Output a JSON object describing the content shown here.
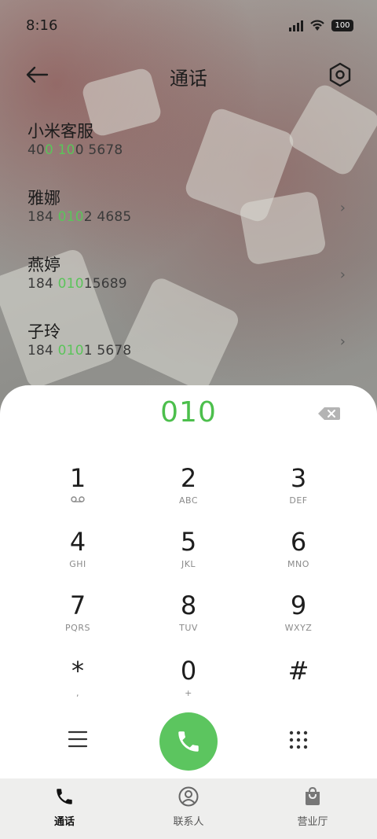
{
  "status_bar": {
    "time": "8:16",
    "battery": "100"
  },
  "header": {
    "title": "通话",
    "back_icon": "arrow-left-icon",
    "settings_icon": "hex-gear-icon"
  },
  "suggestions": [
    {
      "name": "小米客服",
      "number_prefix": "40",
      "number_highlight": "0 10",
      "number_suffix": "0 5678"
    },
    {
      "name": "雅娜",
      "number_prefix": "184 ",
      "number_highlight": "010",
      "number_suffix": "2 4685"
    },
    {
      "name": "燕婷",
      "number_prefix": "184 ",
      "number_highlight": "010",
      "number_suffix": "15689"
    },
    {
      "name": "子玲",
      "number_prefix": "184 ",
      "number_highlight": "010",
      "number_suffix": "1 5678"
    }
  ],
  "dialpad": {
    "dialed": "010",
    "keys": [
      {
        "digit": "1",
        "letters": ""
      },
      {
        "digit": "2",
        "letters": "ABC"
      },
      {
        "digit": "3",
        "letters": "DEF"
      },
      {
        "digit": "4",
        "letters": "GHI"
      },
      {
        "digit": "5",
        "letters": "JKL"
      },
      {
        "digit": "6",
        "letters": "MNO"
      },
      {
        "digit": "7",
        "letters": "PQRS"
      },
      {
        "digit": "8",
        "letters": "TUV"
      },
      {
        "digit": "9",
        "letters": "WXYZ"
      },
      {
        "digit": "*",
        "letters": ","
      },
      {
        "digit": "0",
        "letters": "+"
      },
      {
        "digit": "#",
        "letters": ""
      }
    ]
  },
  "colors": {
    "accent_green": "#5cc55f",
    "highlight_green": "#5bc45a"
  },
  "tabs": [
    {
      "label": "通话",
      "icon": "phone-icon",
      "active": true
    },
    {
      "label": "联系人",
      "icon": "contact-avatar-icon",
      "active": false
    },
    {
      "label": "营业厅",
      "icon": "shopping-bag-icon",
      "active": false
    }
  ]
}
